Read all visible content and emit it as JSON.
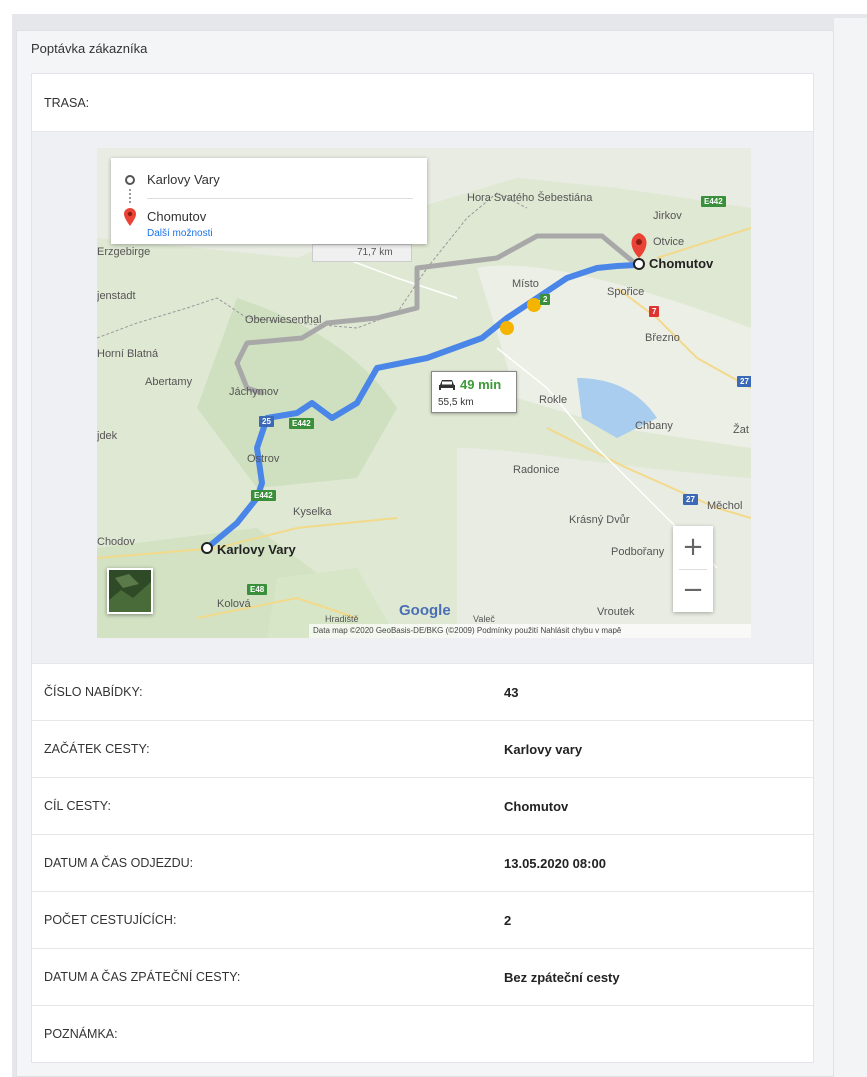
{
  "card_title": "Poptávka zákazníka",
  "route_label": "TRASA:",
  "map": {
    "directions": {
      "origin": "Karlovy Vary",
      "destination": "Chomutov",
      "more_options": "Další možnosti"
    },
    "alt_route_distance": "71,7 km",
    "route_time": "49 min",
    "route_distance": "55,5 km",
    "towns": {
      "hora": "Hora Svatého Šebestiána",
      "jirkov": "Jirkov",
      "otvice": "Otvice",
      "chomutov": "Chomutov",
      "misto": "Místo",
      "sporice": "Spořice",
      "brezno": "Březno",
      "erzgebirge": "Erzgebirge",
      "jenstadt": "jenstadt",
      "oberwiesenthal": "Oberwiesenthal",
      "horni_blatna": "Horní Blatná",
      "abertamy": "Abertamy",
      "jachymov": "Jáchymov",
      "rokle": "Rokle",
      "chbany": "Chbany",
      "zat": "Žat",
      "jdek": "jdek",
      "ostrov": "Ostrov",
      "radonice": "Radonice",
      "kyselka": "Kyselka",
      "mechol": "Měchol",
      "krasny_dvur": "Krásný Dvůr",
      "chodov": "Chodov",
      "karlovy_vary": "Karlovy Vary",
      "podborany": "Podbořany",
      "kolova": "Kolová",
      "vroutek": "Vroutek",
      "hradiste": "Hradiště",
      "valec": "Valeč"
    },
    "shields": {
      "e442_a": "E442",
      "e442_b": "E442",
      "e442_c": "E442",
      "r25": "25",
      "r27": "27",
      "r27b": "27",
      "r7": "7",
      "r2": "2",
      "e48": "E48"
    },
    "zoom_in": "+",
    "zoom_out": "−",
    "google": "Google",
    "attribution": "Data map ©2020 GeoBasis-DE/BKG (©2009)   Podmínky použití   Nahlásit chybu v mapě"
  },
  "rows": [
    {
      "label": "ČÍSLO NABÍDKY:",
      "value": "43"
    },
    {
      "label": "ZAČÁTEK CESTY:",
      "value": "Karlovy vary"
    },
    {
      "label": "CÍL CESTY:",
      "value": "Chomutov"
    },
    {
      "label": "DATUM A ČAS ODJEZDU:",
      "value": "13.05.2020 08:00"
    },
    {
      "label": "POČET CESTUJÍCÍCH:",
      "value": "2"
    },
    {
      "label": "DATUM A ČAS ZPÁTEČNÍ CESTY:",
      "value": "Bez zpáteční cesty"
    },
    {
      "label": "POZNÁMKA:",
      "value": ""
    }
  ],
  "colors": {
    "route_primary": "#4a86e8",
    "route_alt": "#a8a8a8",
    "time_green": "#3c9a36",
    "link_blue": "#1a73e8"
  }
}
